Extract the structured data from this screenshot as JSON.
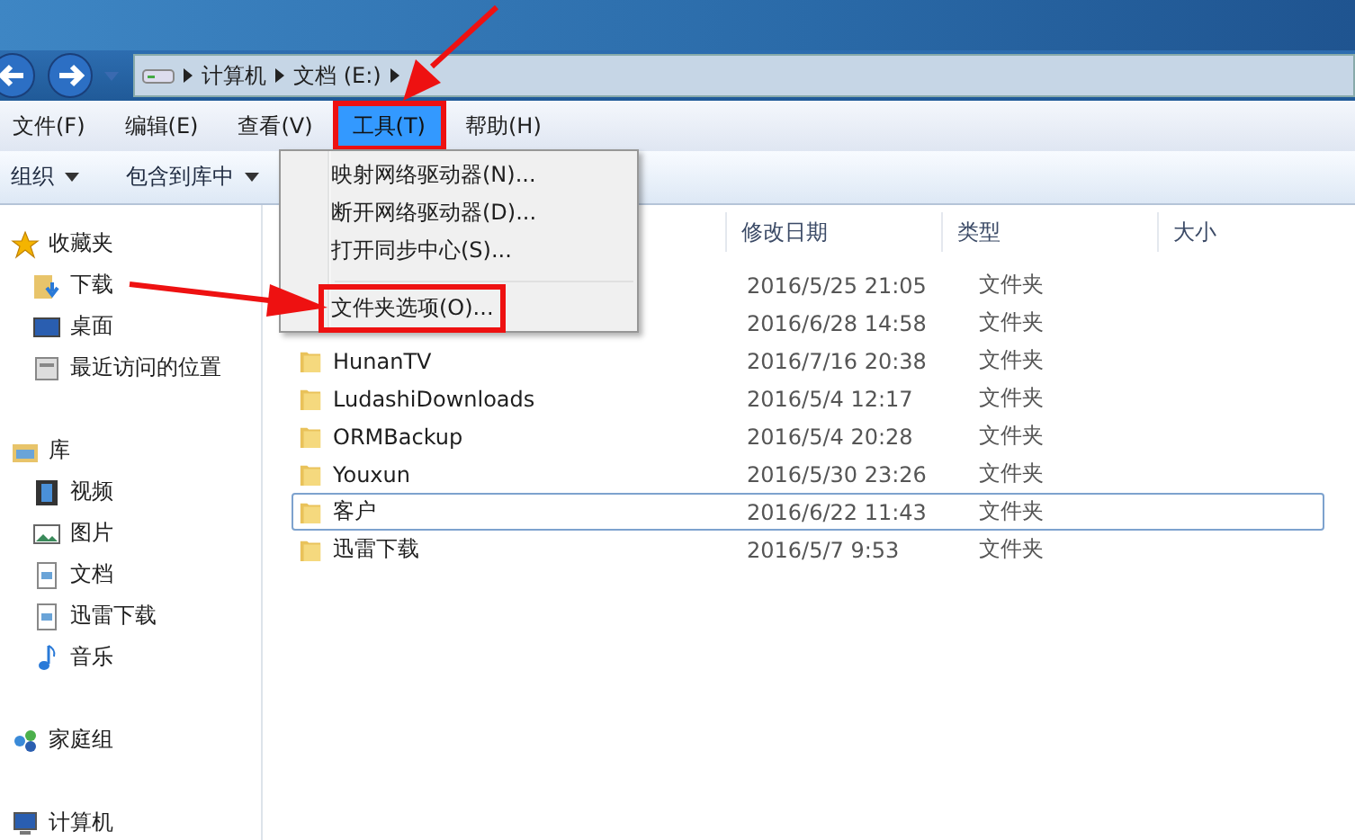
{
  "address_bar": {
    "path": [
      "计算机",
      "文档 (E:)"
    ]
  },
  "menu_bar": [
    {
      "label": "文件(F)",
      "selected": false,
      "annotated": false
    },
    {
      "label": "编辑(E)",
      "selected": false,
      "annotated": false
    },
    {
      "label": "查看(V)",
      "selected": false,
      "annotated": false
    },
    {
      "label": "工具(T)",
      "selected": true,
      "annotated": true
    },
    {
      "label": "帮助(H)",
      "selected": false,
      "annotated": false
    }
  ],
  "toolbar": [
    {
      "label": "组织"
    },
    {
      "label": "包含到库中"
    }
  ],
  "sidebar": [
    {
      "label": "收藏夹",
      "kind": "star",
      "children": [
        {
          "label": "下载",
          "kind": "download"
        },
        {
          "label": "桌面",
          "kind": "desktop"
        },
        {
          "label": "最近访问的位置",
          "kind": "recent"
        }
      ]
    },
    {
      "label": "库",
      "kind": "library",
      "children": [
        {
          "label": "视频",
          "kind": "video"
        },
        {
          "label": "图片",
          "kind": "picture"
        },
        {
          "label": "文档",
          "kind": "document"
        },
        {
          "label": "迅雷下载",
          "kind": "document"
        },
        {
          "label": "音乐",
          "kind": "music"
        }
      ]
    },
    {
      "label": "家庭组",
      "kind": "homegroup"
    },
    {
      "label": "计算机",
      "kind": "computer"
    }
  ],
  "file_list": {
    "columns": [
      "修改日期",
      "类型",
      "大小"
    ],
    "rows": [
      {
        "modified": "2016/5/25 21:05",
        "type": "文件夹",
        "selected": false
      },
      {
        "modified": "2016/6/28 14:58",
        "type": "文件夹",
        "selected": false
      },
      {
        "name": "HunanTV",
        "modified": "2016/7/16 20:38",
        "type": "文件夹",
        "selected": false
      },
      {
        "name": "LudashiDownloads",
        "modified": "2016/5/4 12:17",
        "type": "文件夹",
        "selected": false
      },
      {
        "name": "ORMBackup",
        "modified": "2016/5/4 20:28",
        "type": "文件夹",
        "selected": false
      },
      {
        "name": "Youxun",
        "modified": "2016/5/30 23:26",
        "type": "文件夹",
        "selected": false
      },
      {
        "name": "客户",
        "modified": "2016/6/22 11:43",
        "type": "文件夹",
        "selected": true
      },
      {
        "name": "迅雷下载",
        "modified": "2016/5/7 9:53",
        "type": "文件夹",
        "selected": false
      }
    ]
  },
  "dropdown_menu": [
    {
      "kind": "item",
      "label": "映射网络驱动器(N)...",
      "annotated": false
    },
    {
      "kind": "item",
      "label": "断开网络驱动器(D)...",
      "annotated": false
    },
    {
      "kind": "item",
      "label": "打开同步中心(S)...",
      "annotated": false
    },
    {
      "kind": "separator"
    },
    {
      "kind": "item",
      "label": "文件夹选项(O)...",
      "annotated": true
    }
  ]
}
